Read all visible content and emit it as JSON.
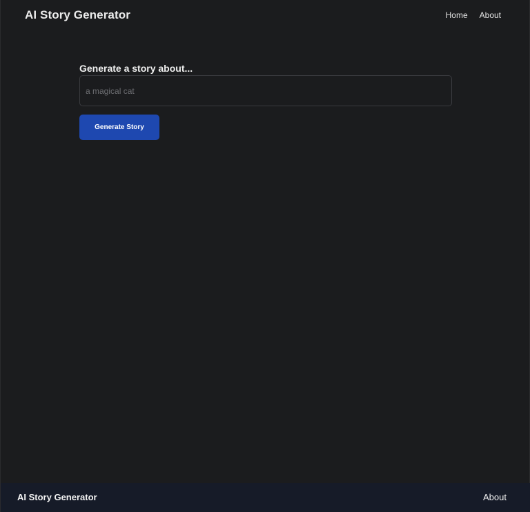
{
  "header": {
    "brand": "AI Story Generator",
    "nav": [
      {
        "label": "Home"
      },
      {
        "label": "About"
      }
    ]
  },
  "form": {
    "label": "Generate a story about...",
    "input_value": "",
    "input_placeholder": "a magical cat",
    "button_label": "Generate Story"
  },
  "footer": {
    "brand": "AI Story Generator",
    "link": "About"
  },
  "colors": {
    "background": "#1b1c1e",
    "accent_button": "#1e48b0",
    "footer_background": "#161b28"
  }
}
